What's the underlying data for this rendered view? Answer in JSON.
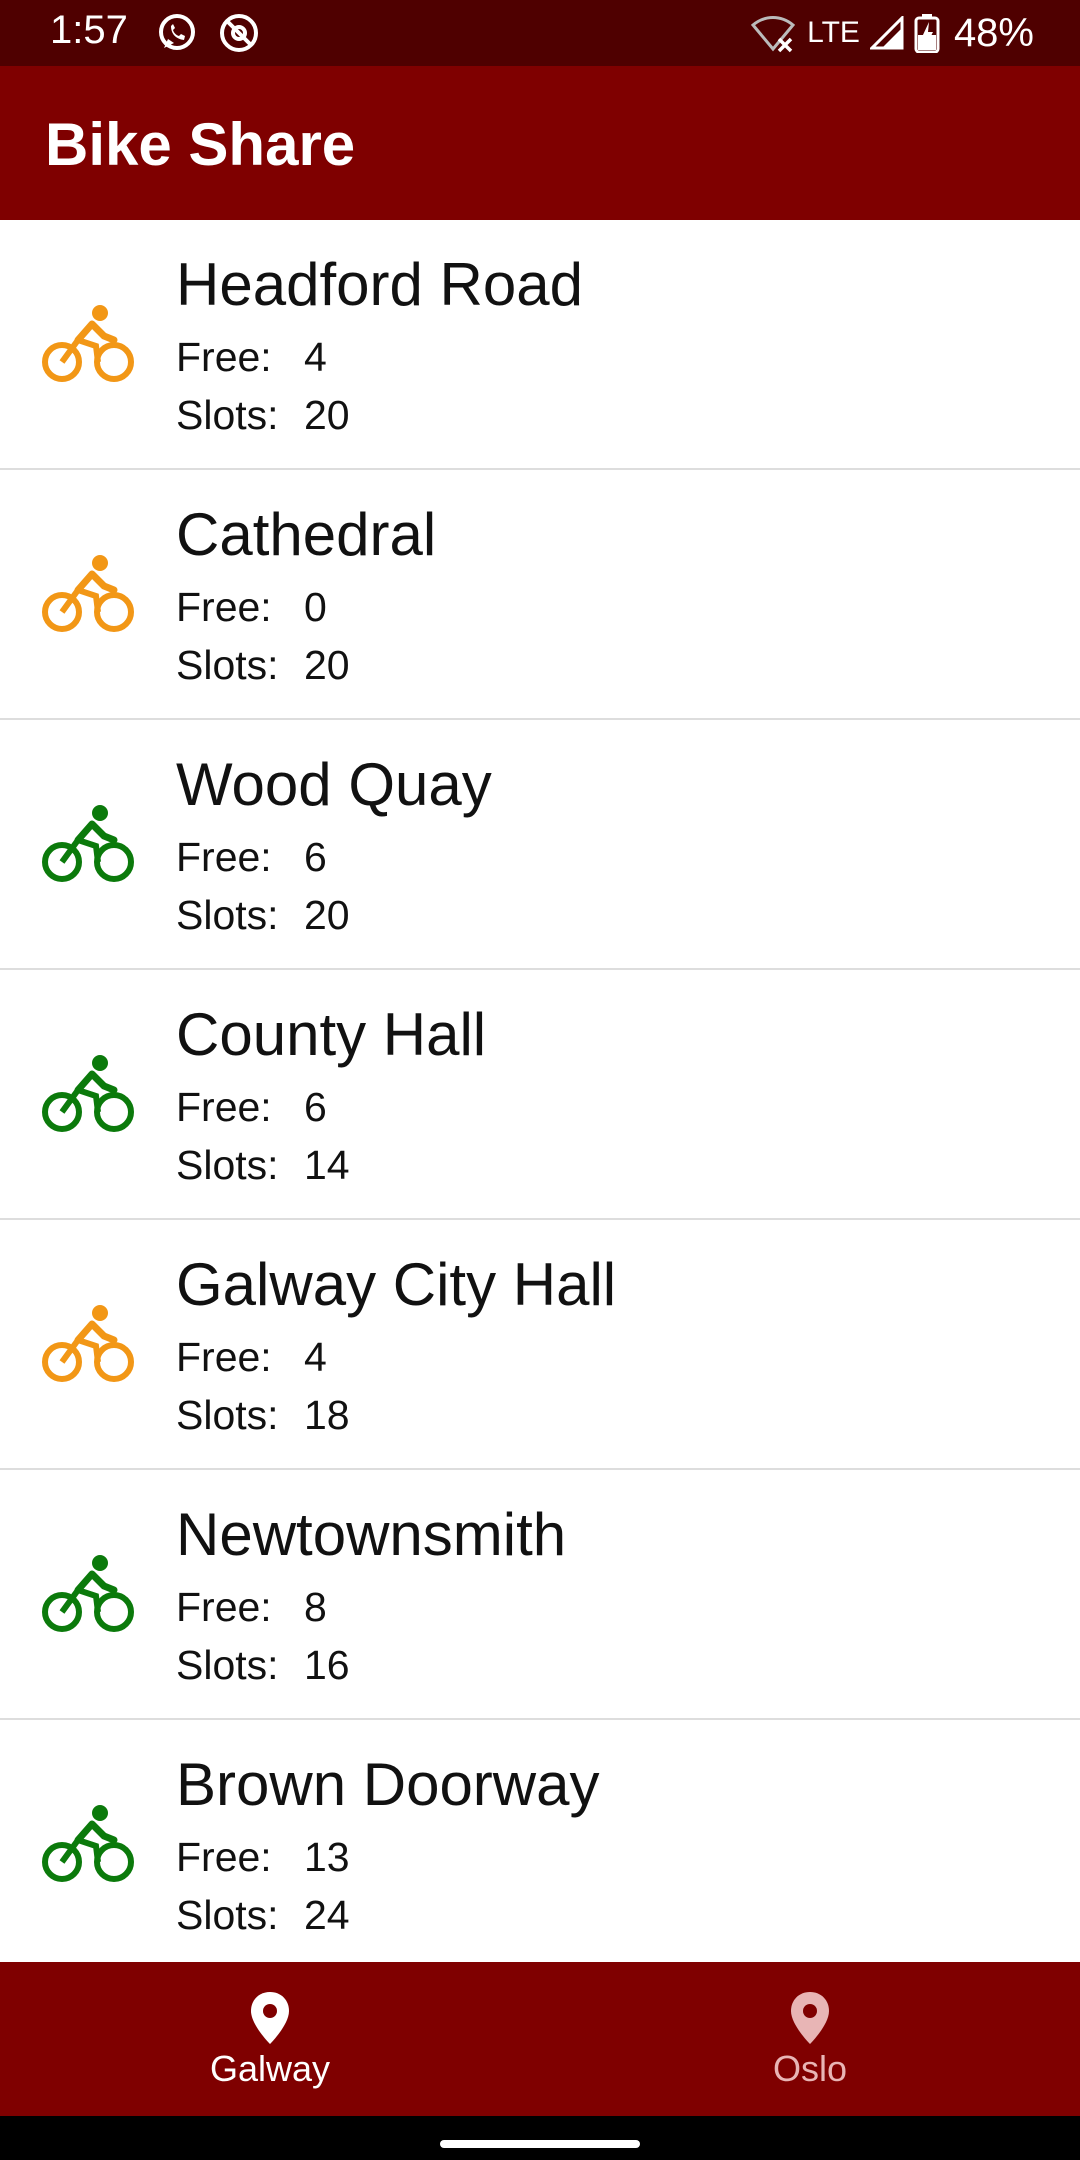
{
  "status_bar": {
    "time": "1:57",
    "network": "LTE",
    "battery": "48%",
    "left_icons": [
      "whatsapp-icon",
      "at-sign-icon"
    ],
    "right_icons": [
      "wifi-off-icon",
      "signal-icon",
      "battery-charging-icon"
    ]
  },
  "app_bar": {
    "title": "Bike Share",
    "color": "#7f0000"
  },
  "colors": {
    "available": "#0b7a0b",
    "low": "#f29716",
    "status_bar": "#4f0000"
  },
  "stations": [
    {
      "name": "Headford Road",
      "free_label": "Free:",
      "free": "4",
      "slots_label": "Slots:",
      "slots": "20",
      "status": "low",
      "icon": "bike-orange-icon"
    },
    {
      "name": "Cathedral",
      "free_label": "Free:",
      "free": "0",
      "slots_label": "Slots:",
      "slots": "20",
      "status": "low",
      "icon": "bike-orange-icon"
    },
    {
      "name": "Wood Quay",
      "free_label": "Free:",
      "free": "6",
      "slots_label": "Slots:",
      "slots": "20",
      "status": "available",
      "icon": "bike-green-icon"
    },
    {
      "name": "County Hall",
      "free_label": "Free:",
      "free": "6",
      "slots_label": "Slots:",
      "slots": "14",
      "status": "available",
      "icon": "bike-green-icon"
    },
    {
      "name": "Galway City Hall",
      "free_label": "Free:",
      "free": "4",
      "slots_label": "Slots:",
      "slots": "18",
      "status": "low",
      "icon": "bike-orange-icon"
    },
    {
      "name": "Newtownsmith",
      "free_label": "Free:",
      "free": "8",
      "slots_label": "Slots:",
      "slots": "16",
      "status": "available",
      "icon": "bike-green-icon"
    },
    {
      "name": "Brown Doorway",
      "free_label": "Free:",
      "free": "13",
      "slots_label": "Slots:",
      "slots": "24",
      "status": "available",
      "icon": "bike-green-icon"
    }
  ],
  "bottom_nav": {
    "items": [
      {
        "label": "Galway",
        "icon": "location-pin-icon",
        "selected": true
      },
      {
        "label": "Oslo",
        "icon": "location-pin-icon",
        "selected": false
      }
    ]
  }
}
